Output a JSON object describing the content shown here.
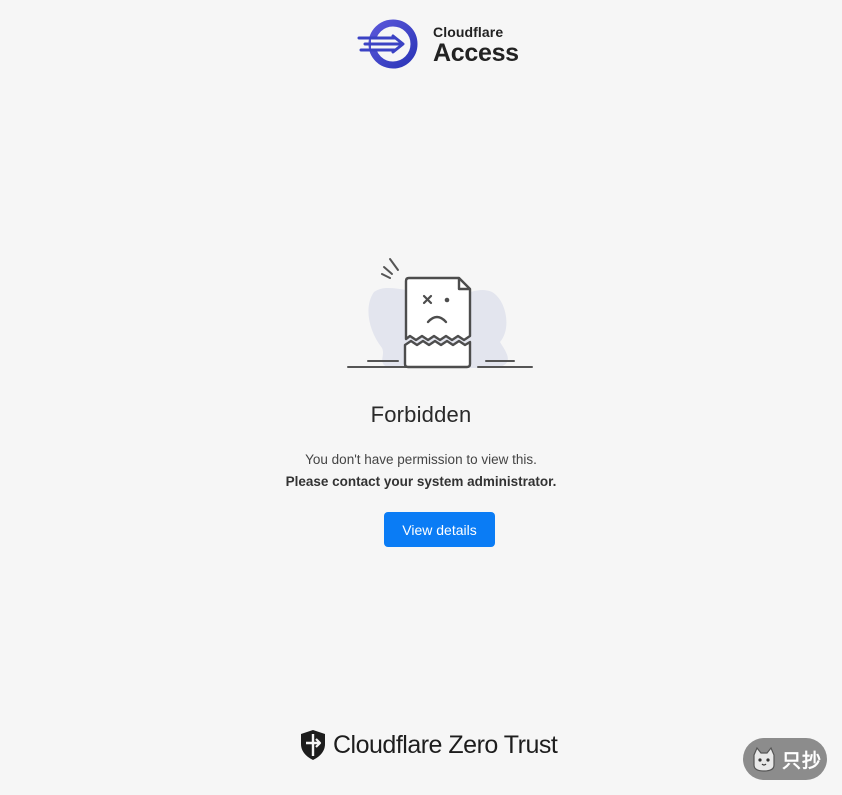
{
  "header": {
    "brand": "Cloudflare",
    "product": "Access",
    "logo_icon": "access-arrow-icon"
  },
  "main": {
    "illustration_icon": "broken-document-icon",
    "title": "Forbidden",
    "message": "You don't have permission to view this.",
    "instruction": "Please contact your system administrator.",
    "button_label": "View details"
  },
  "footer": {
    "brand_text": "Cloudflare Zero Trust",
    "logo_icon": "shield-icon"
  },
  "corner_widget": {
    "label": "只抄",
    "icon": "cat-icon"
  },
  "colors": {
    "background": "#f6f6f6",
    "button": "#0a7cf5",
    "brand_blue": "#3b42c4",
    "illustration_blob": "#e3e5ee"
  }
}
